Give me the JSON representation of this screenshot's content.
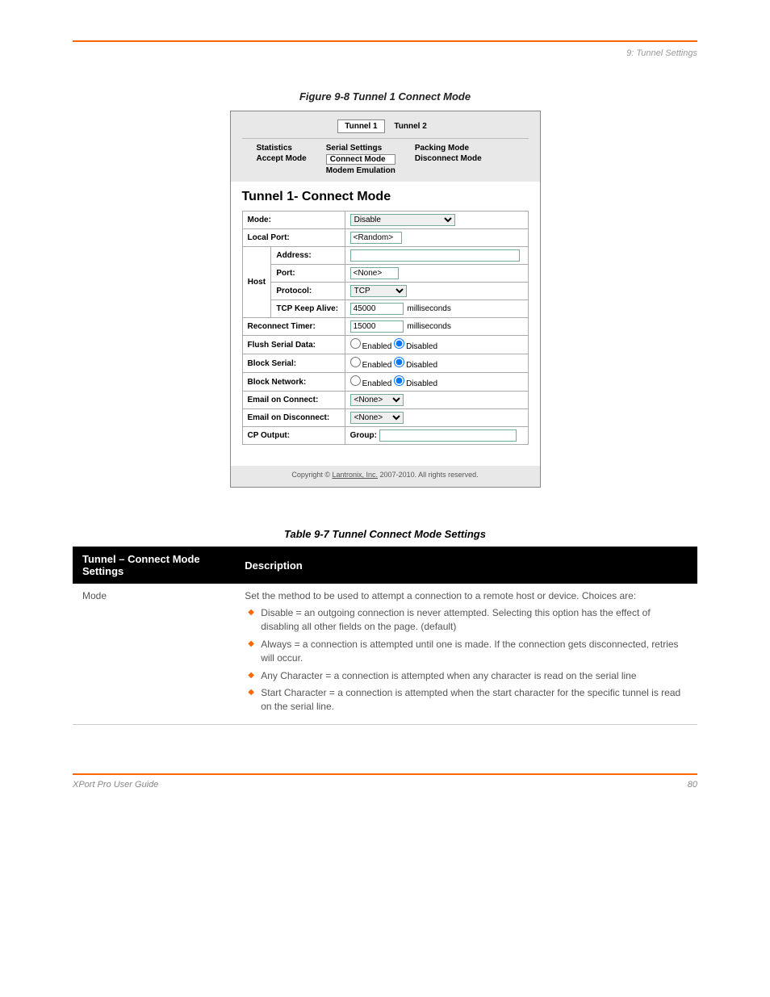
{
  "header": {
    "chapter": "9: Tunnel Settings"
  },
  "figure": {
    "caption": "Figure 9-8  Tunnel 1 Connect Mode"
  },
  "panel": {
    "tabs": {
      "tunnel1": "Tunnel 1",
      "tunnel2": "Tunnel 2"
    },
    "nav": {
      "col1": [
        "Statistics",
        "Accept Mode"
      ],
      "col2": [
        "Serial Settings",
        "Connect Mode",
        "Modem Emulation"
      ],
      "col2_boxed_index": 1,
      "col3": [
        "Packing Mode",
        "Disconnect Mode"
      ]
    },
    "title": "Tunnel 1- Connect Mode",
    "rows": {
      "mode_label": "Mode:",
      "mode_value": "Disable",
      "local_port_label": "Local Port:",
      "local_port_value": "<Random>",
      "host_label": "Host",
      "address_label": "Address:",
      "address_value": "",
      "port_label": "Port:",
      "port_value": "<None>",
      "protocol_label": "Protocol:",
      "protocol_value": "TCP",
      "tcp_keep_label": "TCP Keep Alive:",
      "tcp_keep_value": "45000",
      "tcp_keep_unit": "milliseconds",
      "reconnect_label": "Reconnect Timer:",
      "reconnect_value": "15000",
      "reconnect_unit": "milliseconds",
      "flush_label": "Flush Serial Data:",
      "block_serial_label": "Block Serial:",
      "block_network_label": "Block Network:",
      "enabled_label": "Enabled",
      "disabled_label": "Disabled",
      "email_connect_label": "Email on Connect:",
      "email_connect_value": "<None>",
      "email_disconnect_label": "Email on Disconnect:",
      "email_disconnect_value": "<None>",
      "cp_output_label": "CP Output:",
      "cp_output_group": "Group:",
      "cp_output_value": ""
    },
    "footer": {
      "prefix": "Copyright © ",
      "link": "Lantronix, Inc.",
      "suffix": " 2007-2010. All rights reserved."
    }
  },
  "table": {
    "caption": "Table 9-7  Tunnel Connect Mode Settings",
    "headers": [
      "Tunnel – Connect Mode Settings",
      "Description"
    ],
    "row1": {
      "field": "Mode",
      "intro": "Set the method to be used to attempt a connection to a remote host or device. Choices are:",
      "items": [
        "Disable = an outgoing connection is never attempted. Selecting this option has the effect of disabling all other fields on the page. (default)",
        "Always = a connection is attempted until one is made. If the connection gets disconnected, retries will occur.",
        "Any Character = a connection is attempted when any character is read on the serial line",
        "Start Character = a connection is attempted when the start character for the specific tunnel is read on the serial line."
      ]
    }
  },
  "footer": {
    "doc": "XPort Pro User Guide",
    "page": "80"
  }
}
